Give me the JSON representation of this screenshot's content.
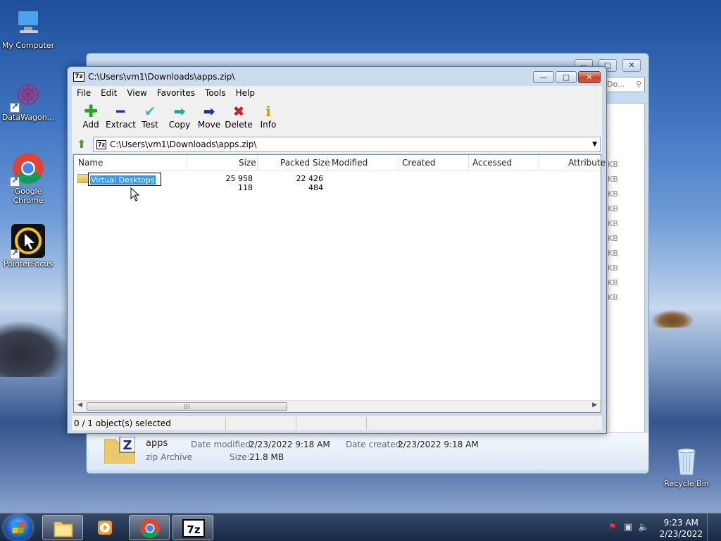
{
  "desktop": {
    "icons": [
      {
        "label": "My Computer",
        "icon": "computer-icon"
      },
      {
        "label": "DataWagon...",
        "icon": "datawagon-icon"
      },
      {
        "label": "Google\nChrome",
        "label_line1": "Google",
        "label_line2": "Chrome",
        "icon": "chrome-icon"
      },
      {
        "label": "PointerFocus",
        "icon": "pointerfocus-icon"
      },
      {
        "label": "Recycle Bin",
        "icon": "recycle-bin-icon"
      }
    ]
  },
  "bg_window": {
    "search_placeholder": "Do...",
    "size_unit": "KB",
    "details": {
      "name": "apps",
      "type": "zip Archive",
      "modified_label": "Date modified:",
      "modified_value": "2/23/2022 9:18 AM",
      "created_label": "Date created:",
      "created_value": "2/23/2022 9:18 AM",
      "size_label": "Size:",
      "size_value": "21.8 MB"
    }
  },
  "zip_window": {
    "title": "C:\\Users\\vm1\\Downloads\\apps.zip\\",
    "logo_text": "7z",
    "menu": [
      "File",
      "Edit",
      "View",
      "Favorites",
      "Tools",
      "Help"
    ],
    "toolbar": [
      {
        "label": "Add",
        "icon": "add-icon",
        "glyph": "✚",
        "color": "#1faa1f"
      },
      {
        "label": "Extract",
        "icon": "extract-icon",
        "glyph": "━",
        "color": "#1a2fbf"
      },
      {
        "label": "Test",
        "icon": "test-icon",
        "glyph": "✔",
        "color": "#3cb8b0"
      },
      {
        "label": "Copy",
        "icon": "copy-icon",
        "glyph": "➡",
        "color": "#2aa09a"
      },
      {
        "label": "Move",
        "icon": "move-icon",
        "glyph": "➡",
        "color": "#1a2fa0"
      },
      {
        "label": "Delete",
        "icon": "delete-icon",
        "glyph": "✖",
        "color": "#d41a1a"
      },
      {
        "label": "Info",
        "icon": "info-icon",
        "glyph": "i",
        "color": "#c9a100"
      }
    ],
    "address": "C:\\Users\\vm1\\Downloads\\apps.zip\\",
    "columns": [
      "Name",
      "Size",
      "Packed Size",
      "Modified",
      "Created",
      "Accessed",
      "Attribute"
    ],
    "rows": [
      {
        "name": "Virtual Desktops",
        "size": "25 958 118",
        "packed": "22 426 484"
      }
    ],
    "status": "0 / 1 object(s) selected"
  },
  "taskbar": {
    "time": "9:23 AM",
    "date": "2/23/2022",
    "apps": [
      "explorer-icon",
      "media-player-icon",
      "chrome-icon",
      "7zip-icon"
    ],
    "active_app": "7zip-icon"
  }
}
